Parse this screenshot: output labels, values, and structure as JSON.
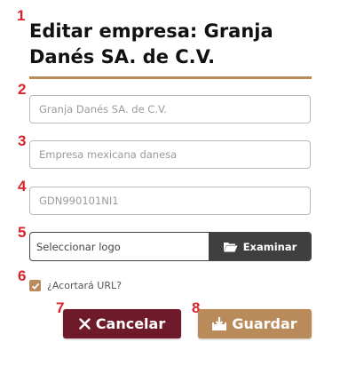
{
  "markers": [
    "1",
    "2",
    "3",
    "4",
    "5",
    "6",
    "7",
    "8"
  ],
  "header": {
    "title_line1": "Editar empresa: Granja",
    "title_line2": "Danés SA. de C.V."
  },
  "form": {
    "name_placeholder": "Granja Danés SA. de C.V.",
    "description_placeholder": "Empresa mexicana danesa",
    "rfc_placeholder": "GDN990101NI1",
    "logo_placeholder": "Seleccionar logo",
    "browse_label": "Examinar",
    "shorten_url_label": "¿Acortará URL?",
    "shorten_url_checked": true
  },
  "actions": {
    "cancel_label": "Cancelar",
    "save_label": "Guardar"
  },
  "colors": {
    "accent": "#b98a5a",
    "cancel": "#6e1a2b",
    "browse": "#3f3f3f",
    "marker": "#d9232a"
  },
  "icons": {
    "browse": "folder-open-icon",
    "cancel": "close-icon",
    "save": "save-download-icon",
    "checkbox": "checkmark-icon"
  }
}
